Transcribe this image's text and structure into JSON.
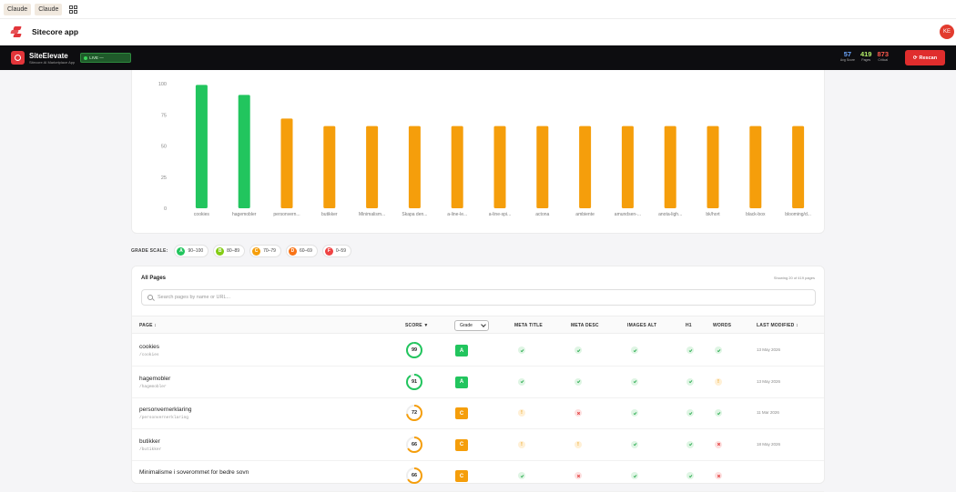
{
  "browser": {
    "tabs": [
      "Claude",
      "Claude"
    ]
  },
  "app": {
    "title": "Sitecore app",
    "avatar_initials": "KE"
  },
  "toolbar": {
    "brand": "SiteElevate",
    "brand_sub": "Sitecore AI Marketplace App",
    "live_label": "LIVE —",
    "stats": [
      {
        "value": "57",
        "label": "Avg Score",
        "color": "#6ea8ff"
      },
      {
        "value": "419",
        "label": "Pages",
        "color": "#b6f26a"
      },
      {
        "value": "873",
        "label": "Critical",
        "color": "#ff5a4e"
      }
    ],
    "rescan_label": "Rescan"
  },
  "chart_data": {
    "type": "bar",
    "categories": [
      "cookies",
      "hagemobler",
      "personvern...",
      "butikker",
      "Minimalism...",
      "Skapa den...",
      "a-line-le...",
      "a-line-spi...",
      "actona",
      "ambiente",
      "amundsen-...",
      "anota-ligh...",
      "bk/hort",
      "black-box",
      "blooming/d..."
    ],
    "values": [
      99,
      91,
      72,
      66,
      66,
      66,
      66,
      66,
      66,
      66,
      66,
      66,
      66,
      66,
      66
    ],
    "colors": [
      "#22c55e",
      "#22c55e",
      "#f59e0b",
      "#f59e0b",
      "#f59e0b",
      "#f59e0b",
      "#f59e0b",
      "#f59e0b",
      "#f59e0b",
      "#f59e0b",
      "#f59e0b",
      "#f59e0b",
      "#f59e0b",
      "#f59e0b",
      "#f59e0b"
    ],
    "yticks": [
      0,
      25,
      50,
      75,
      100
    ],
    "ylim": [
      0,
      100
    ],
    "grid": false,
    "legend": "none"
  },
  "grade_scale": {
    "label": "GRADE SCALE:",
    "grades": [
      {
        "letter": "A",
        "range": "90–100",
        "color": "#22c55e"
      },
      {
        "letter": "B",
        "range": "80–89",
        "color": "#84cc16"
      },
      {
        "letter": "C",
        "range": "70–79",
        "color": "#f59e0b"
      },
      {
        "letter": "D",
        "range": "60–69",
        "color": "#f97316"
      },
      {
        "letter": "F",
        "range": "0–59",
        "color": "#ef4444"
      }
    ]
  },
  "table": {
    "title": "All Pages",
    "showing": "Showing 20 of 419 pages",
    "search_placeholder": "Search pages by name or URL...",
    "headers": {
      "page": "PAGE ↕",
      "score": "SCORE ▼",
      "grade": "Grade",
      "meta_title": "META TITLE",
      "meta_desc": "META DESC",
      "images_alt": "IMAGES ALT",
      "h1": "H1",
      "words": "WORDS",
      "modified": "LAST MODIFIED ↕"
    },
    "rows": [
      {
        "name": "cookies",
        "path": "/cookies",
        "score": "99",
        "score_pct": 99,
        "score_color": "#22c55e",
        "grade": "A",
        "grade_color": "#22c55e",
        "meta_title": "ok",
        "meta_desc": "ok",
        "images_alt": "ok",
        "h1": "ok",
        "words": "ok",
        "modified": "13 May 2026"
      },
      {
        "name": "hagemobler",
        "path": "/hagemobler",
        "score": "91",
        "score_pct": 91,
        "score_color": "#22c55e",
        "grade": "A",
        "grade_color": "#22c55e",
        "meta_title": "ok",
        "meta_desc": "ok",
        "images_alt": "ok",
        "h1": "ok",
        "words": "warn",
        "modified": "13 May 2026"
      },
      {
        "name": "personvernerklaring",
        "path": "/personvernerklaring",
        "score": "72",
        "score_pct": 72,
        "score_color": "#f59e0b",
        "grade": "C",
        "grade_color": "#f59e0b",
        "meta_title": "warn",
        "meta_desc": "bad",
        "images_alt": "ok",
        "h1": "ok",
        "words": "ok",
        "modified": "11 Mar 2026"
      },
      {
        "name": "butikker",
        "path": "/butikker",
        "score": "66",
        "score_pct": 66,
        "score_color": "#f59e0b",
        "grade": "C",
        "grade_color": "#f59e0b",
        "meta_title": "warn",
        "meta_desc": "warn",
        "images_alt": "ok",
        "h1": "ok",
        "words": "bad",
        "modified": "18 May 2026"
      },
      {
        "name": "Minimalisme i soverommet for bedre sovn",
        "path": "",
        "score": "66",
        "score_pct": 66,
        "score_color": "#f59e0b",
        "grade": "C",
        "grade_color": "#f59e0b",
        "meta_title": "ok",
        "meta_desc": "bad",
        "images_alt": "ok",
        "h1": "ok",
        "words": "bad",
        "modified": ""
      }
    ]
  }
}
